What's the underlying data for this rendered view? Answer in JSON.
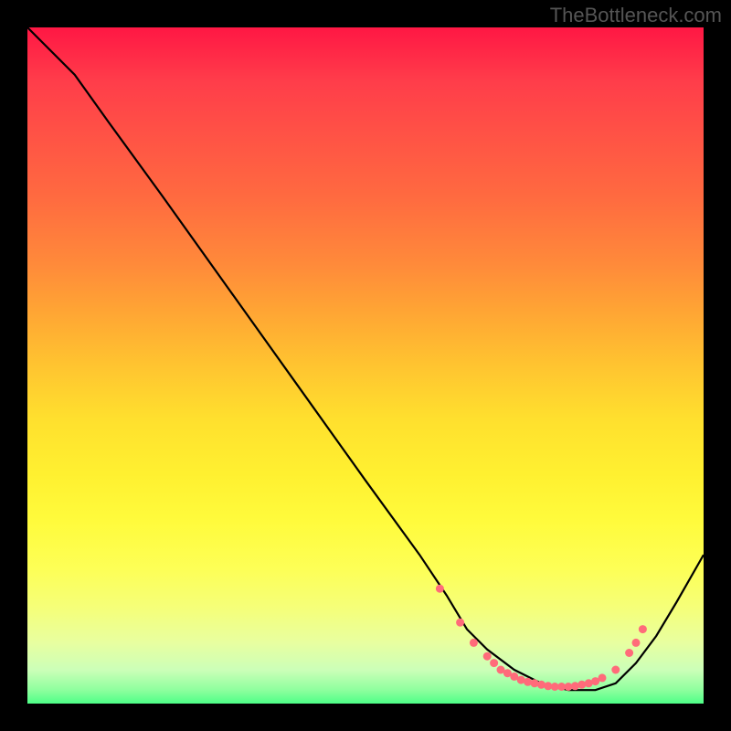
{
  "watermark": "TheBottleneck.com",
  "chart_data": {
    "type": "line",
    "title": "",
    "xlabel": "",
    "ylabel": "",
    "xlim": [
      0,
      100
    ],
    "ylim": [
      0,
      100
    ],
    "series": [
      {
        "name": "bottleneck-curve",
        "x": [
          0,
          7,
          12,
          20,
          30,
          40,
          50,
          58,
          62,
          65,
          68,
          72,
          76,
          80,
          84,
          87,
          90,
          93,
          96,
          100
        ],
        "y": [
          100,
          93,
          86,
          75,
          61,
          47,
          33,
          22,
          16,
          11,
          8,
          5,
          3,
          2,
          2,
          3,
          6,
          10,
          15,
          22
        ],
        "color": "#000000"
      }
    ],
    "markers": {
      "name": "highlight-dots",
      "x": [
        61,
        64,
        66,
        68,
        69,
        70,
        71,
        72,
        73,
        74,
        75,
        76,
        77,
        78,
        79,
        80,
        81,
        82,
        83,
        84,
        85,
        87,
        89,
        90,
        91
      ],
      "y": [
        17,
        12,
        9,
        7,
        6,
        5,
        4.5,
        4,
        3.5,
        3.2,
        3,
        2.8,
        2.6,
        2.5,
        2.5,
        2.5,
        2.6,
        2.8,
        3,
        3.3,
        3.8,
        5,
        7.5,
        9,
        11
      ],
      "color": "#ff6b7a"
    },
    "gradient_stops": [
      {
        "pos": 0,
        "color": "#ff1744"
      },
      {
        "pos": 50,
        "color": "#ffc430"
      },
      {
        "pos": 80,
        "color": "#fdff56"
      },
      {
        "pos": 100,
        "color": "#4eff87"
      }
    ]
  }
}
